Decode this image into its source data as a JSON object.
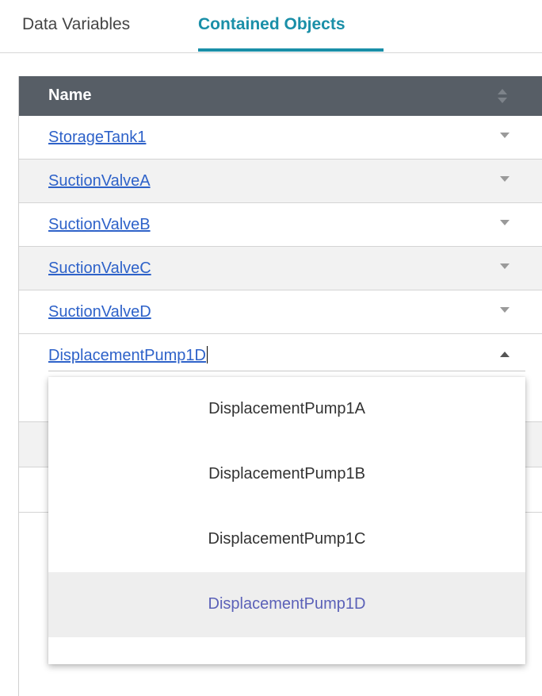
{
  "tabs": [
    {
      "label": "Data Variables",
      "active": false
    },
    {
      "label": "Contained Objects",
      "active": true
    }
  ],
  "colors": {
    "accent": "#1a8fa8",
    "header_bg": "#575e66",
    "link": "#2e62c9",
    "selected_option_text": "#5b61b8"
  },
  "table": {
    "columns": [
      {
        "label": "Name",
        "sort_icon": "sort-icon"
      }
    ],
    "rows": [
      {
        "name": "StorageTank1",
        "caret": "down"
      },
      {
        "name": "SuctionValveA",
        "caret": "down"
      },
      {
        "name": "SuctionValveB",
        "caret": "down"
      },
      {
        "name": "SuctionValveC",
        "caret": "down"
      },
      {
        "name": "SuctionValveD",
        "caret": "down"
      },
      {
        "name": "DisplacementPump1D",
        "caret": "up",
        "editing": true
      }
    ]
  },
  "dropdown": {
    "options": [
      {
        "label": "DisplacementPump1A",
        "selected": false
      },
      {
        "label": "DisplacementPump1B",
        "selected": false
      },
      {
        "label": "DisplacementPump1C",
        "selected": false
      },
      {
        "label": "DisplacementPump1D",
        "selected": true
      }
    ]
  }
}
